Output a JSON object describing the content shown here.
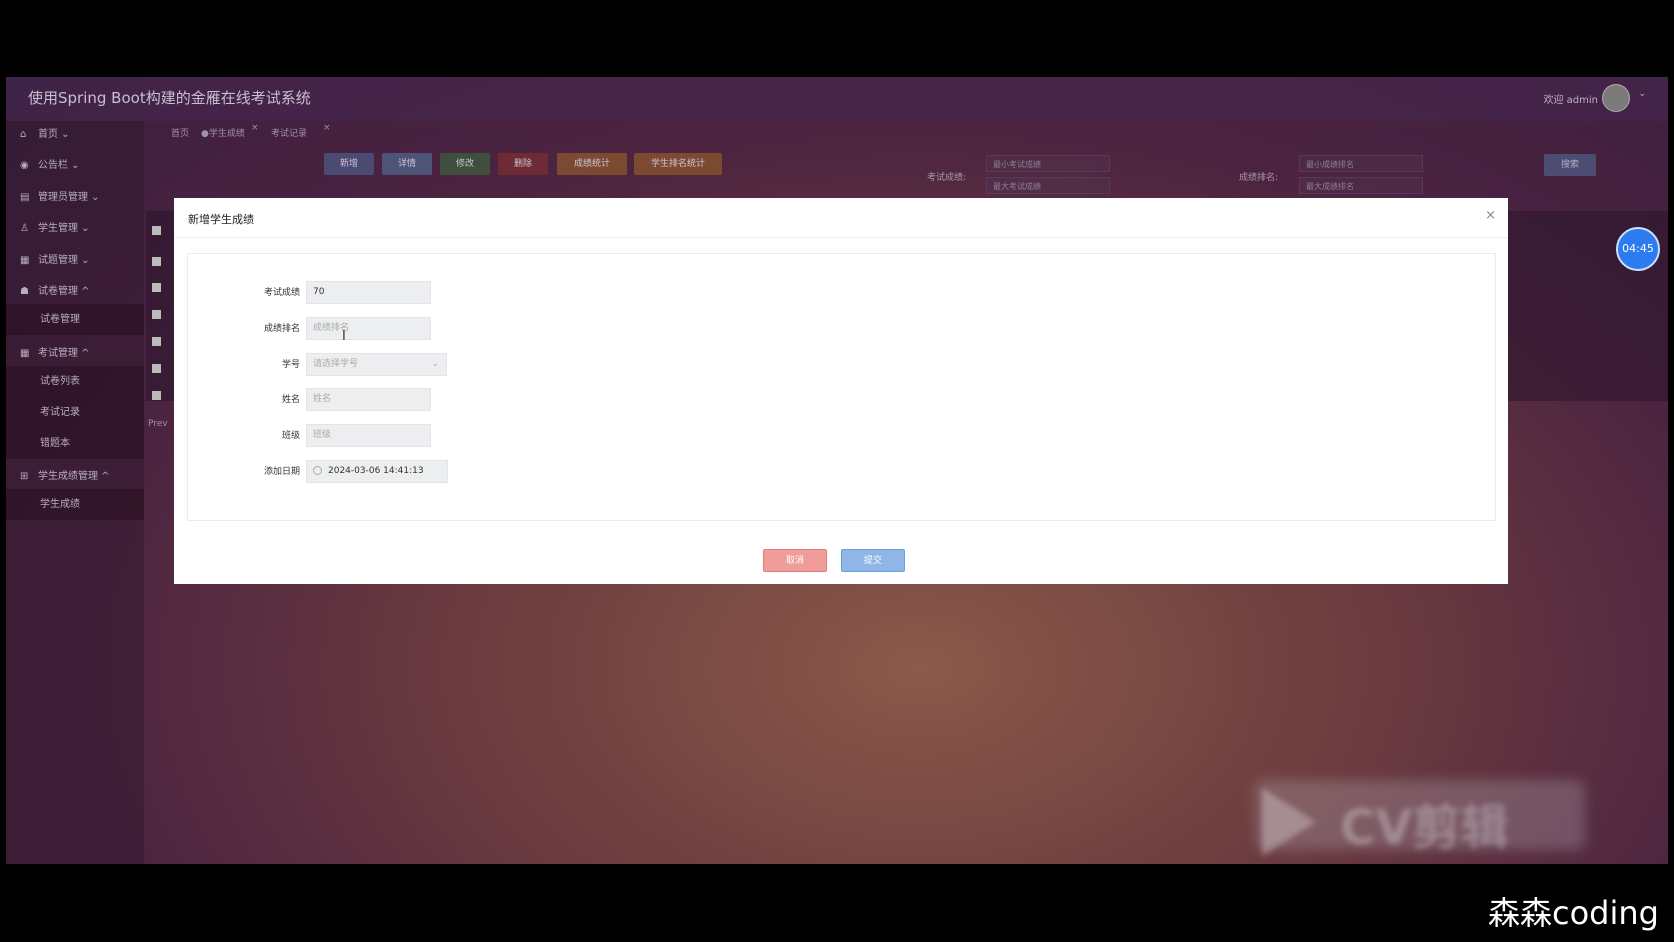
{
  "app": {
    "title": "使用Spring Boot构建的金雁在线考试系统",
    "welcome": "欢迎 admin"
  },
  "sidebar": {
    "items": [
      {
        "label": "首页",
        "icon": "home-icon",
        "caret": "⌄"
      },
      {
        "label": "公告栏",
        "icon": "notice-icon",
        "caret": "⌄"
      },
      {
        "label": "管理员管理",
        "icon": "admin-icon",
        "caret": "⌄"
      },
      {
        "label": "学生管理",
        "icon": "user-icon",
        "caret": "⌄"
      },
      {
        "label": "试题管理",
        "icon": "grid-icon",
        "caret": "⌄"
      },
      {
        "label": "试卷管理",
        "icon": "paper-icon",
        "caret": "^"
      },
      {
        "label": "试卷管理",
        "sub": true
      },
      {
        "label": "考试管理",
        "icon": "exam-icon",
        "caret": "^"
      },
      {
        "label": "试卷列表",
        "sub": true
      },
      {
        "label": "考试记录",
        "sub": true
      },
      {
        "label": "错题本",
        "sub": true
      },
      {
        "label": "学生成绩管理",
        "icon": "score-icon",
        "caret": "^"
      },
      {
        "label": "学生成绩",
        "sub": true
      }
    ]
  },
  "tabs": [
    {
      "label": "首页"
    },
    {
      "label": "●学生成绩",
      "close": "×"
    },
    {
      "label": "考试记录",
      "close": "×"
    }
  ],
  "toolbar": {
    "add": "新增",
    "detail": "详情",
    "edit": "修改",
    "delete": "删除",
    "score_stats": "成绩统计",
    "rank_stats": "学生排名统计"
  },
  "filters": {
    "score_label": "考试成绩:",
    "score_min_ph": "最小考试成绩",
    "score_max_ph": "最大考试成绩",
    "rank_label": "成绩排名:",
    "rank_min_ph": "最小成绩排名",
    "rank_max_ph": "最大成绩排名",
    "search": "搜索"
  },
  "pagination": {
    "prev": "Prev"
  },
  "timer": "04:45",
  "modal": {
    "title": "新增学生成绩",
    "close": "×",
    "fields": {
      "score_label": "考试成绩",
      "score_value": "70",
      "rank_label": "成绩排名",
      "rank_placeholder": "成绩排名",
      "student_no_label": "学号",
      "student_no_placeholder": "请选择学号",
      "name_label": "姓名",
      "name_placeholder": "姓名",
      "class_label": "班级",
      "class_placeholder": "班级",
      "date_label": "添加日期",
      "date_value": "2024-03-06 14:41:13"
    },
    "cancel": "取消",
    "submit": "提交"
  },
  "watermark": {
    "text": "CV剪辑"
  },
  "credit": "森森coding",
  "colors": {
    "cancel": "#f09c9a",
    "submit": "#8fb6e6",
    "timer": "#2d7bf0"
  }
}
